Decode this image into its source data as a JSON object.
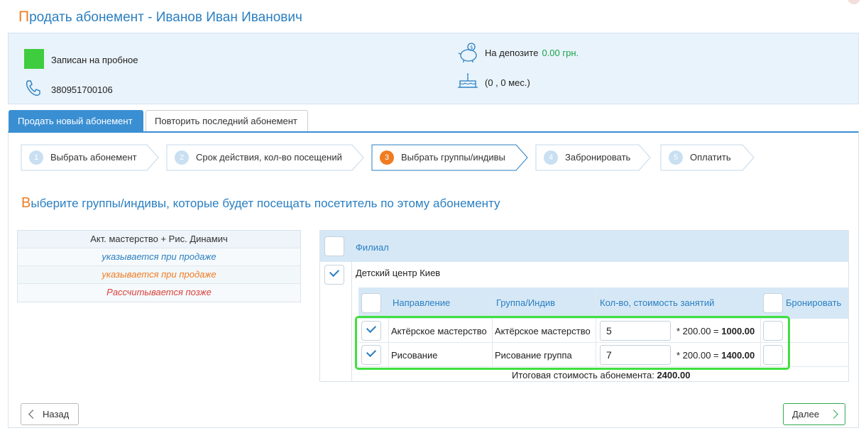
{
  "page": {
    "title_first_letter": "П",
    "title_rest": "родать абонемент - Иванов Иван Иванович"
  },
  "client": {
    "status_color": "#3fcc3f",
    "status_text": "Записан на пробное",
    "phone": "380951700106",
    "deposit_label": "На депозите",
    "deposit_value": "0.00 грн.",
    "age_text": "(0 , 0 мес.)"
  },
  "tabs": [
    {
      "label": "Продать новый абонемент",
      "active": true
    },
    {
      "label": "Повторить последний абонемент",
      "active": false
    }
  ],
  "steps": [
    {
      "num": "1",
      "label": "Выбрать абонемент"
    },
    {
      "num": "2",
      "label": "Срок действия, кол-во посещений"
    },
    {
      "num": "3",
      "label": "Выбрать группы/индивы",
      "current": true
    },
    {
      "num": "4",
      "label": "Забронировать"
    },
    {
      "num": "5",
      "label": "Оплатить"
    }
  ],
  "heading": {
    "first_letter": "В",
    "rest": "ыберите группы/индивы, которые будет посещать посетитель по этому абонементу"
  },
  "summary": {
    "name": "Акт. мастерство + Рис. Динамич",
    "line1": "указывается при продаже",
    "line2": "указывается при продаже",
    "line3": "Рассчитывается позже"
  },
  "grid": {
    "header": "Филиал",
    "branch": "Детский центр Киев",
    "columns": {
      "direction": "Направление",
      "group": "Группа/Индив",
      "qty_cost": "Кол-во, стоимость занятий",
      "book": "Бронировать"
    },
    "rows": [
      {
        "direction": "Актёрское мастерство",
        "group": "Актёрское мастерство",
        "qty": "5",
        "price_prefix": "* 200.00 = ",
        "sum": "1000.00",
        "checked": true
      },
      {
        "direction": "Рисование",
        "group": "Рисование группа",
        "qty": "7",
        "price_prefix": "* 200.00 = ",
        "sum": "1400.00",
        "checked": true
      }
    ],
    "total_label": "Итоговая стоимость абонемента: ",
    "total_value": "2400.00"
  },
  "buttons": {
    "back": "Назад",
    "next": "Далее"
  },
  "colors": {
    "accent": "#2a7fc1",
    "orange": "#f07c21",
    "green": "#1aa34a",
    "highlight": "#3fe03f"
  }
}
